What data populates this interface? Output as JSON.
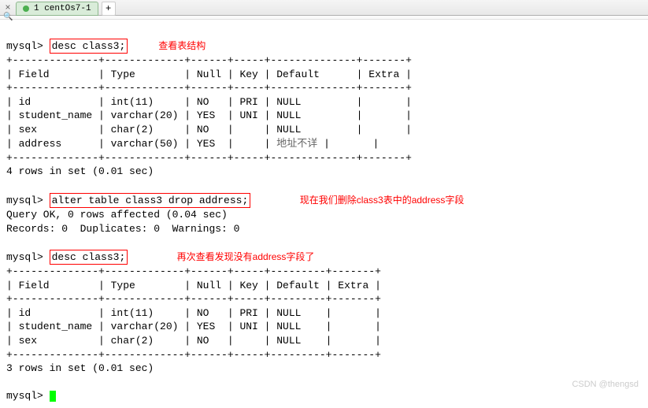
{
  "titlebar": {
    "close_x": "×",
    "tab_label": "1 centOs7-1",
    "add_label": "+"
  },
  "annotations": {
    "a1": "查看表结构",
    "a2": "现在我们删除class3表中的address字段",
    "a3": "再次查看发现没有address字段了",
    "addr_default": "地址不详"
  },
  "prompts": {
    "mysql": "mysql>",
    "cmd1": "desc class3;",
    "cmd2": "alter table class3 drop address;",
    "cmd3": "desc class3;"
  },
  "table1": {
    "border_top": "+--------------+-------------+------+-----+--------------+-------+",
    "header": "| Field        | Type        | Null | Key | Default      | Extra |",
    "r1": "| id           | int(11)     | NO   | PRI | NULL         |       |",
    "r2": "| student_name | varchar(20) | YES  | UNI | NULL         |       |",
    "r3": "| sex          | char(2)     | NO   |     | NULL         |       |",
    "r4a": "| address      | varchar(50) | YES  |     | ",
    "r4b": " |       |",
    "summary": "4 rows in set (0.01 sec)"
  },
  "alter": {
    "ok": "Query OK, 0 rows affected (0.04 sec)",
    "rec": "Records: 0  Duplicates: 0  Warnings: 0"
  },
  "table2": {
    "border_top": "+--------------+-------------+------+-----+---------+-------+",
    "header": "| Field        | Type        | Null | Key | Default | Extra |",
    "r1": "| id           | int(11)     | NO   | PRI | NULL    |       |",
    "r2": "| student_name | varchar(20) | YES  | UNI | NULL    |       |",
    "r3": "| sex          | char(2)     | NO   |     | NULL    |       |",
    "summary": "3 rows in set (0.01 sec)"
  },
  "watermark": "CSDN @thengsd"
}
